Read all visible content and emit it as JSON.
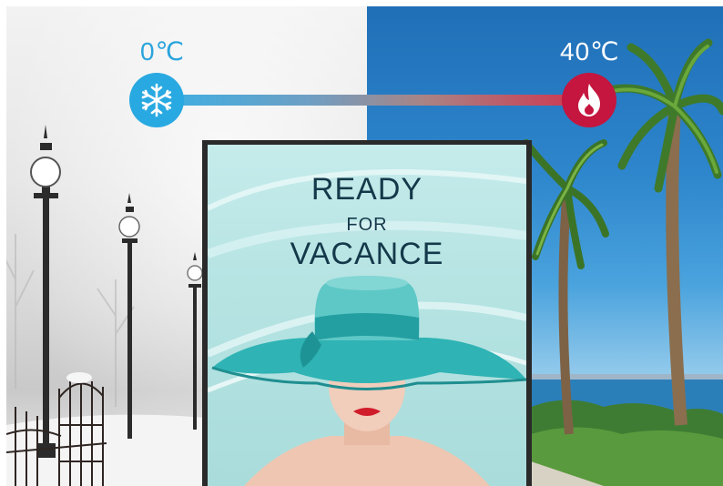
{
  "temperature": {
    "cold_label": "0℃",
    "hot_label": "40℃",
    "cold_icon": "snowflake-icon",
    "hot_icon": "flame-icon",
    "cold_color": "#29a9e1",
    "hot_color": "#c4163e"
  },
  "poster": {
    "line1": "READY",
    "line2": "FOR",
    "line3": "VACANCE",
    "text_color": "#14394a",
    "accent_color": "#2fb3b4"
  }
}
